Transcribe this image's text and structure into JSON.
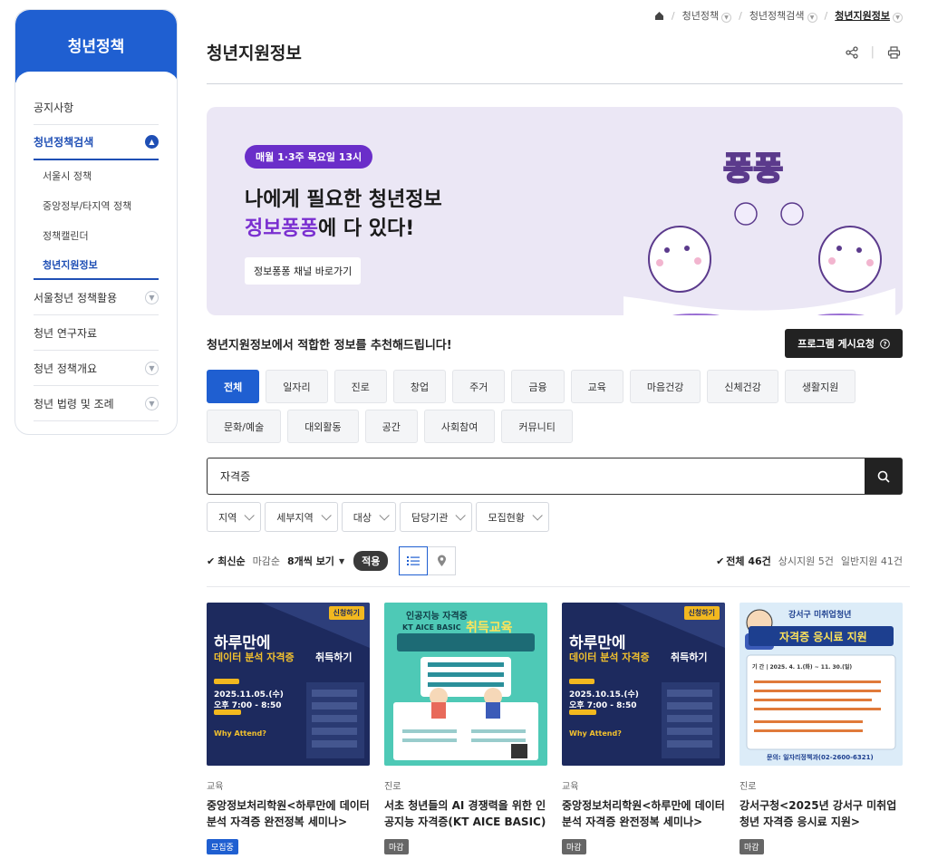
{
  "sidebar": {
    "title": "청년정책",
    "items": [
      {
        "label": "공지사항"
      },
      {
        "label": "청년정책검색"
      },
      {
        "label": "서울청년 정책활용"
      },
      {
        "label": "청년 연구자료"
      },
      {
        "label": "청년 정책개요"
      },
      {
        "label": "청년 법령 및 조례"
      }
    ],
    "subitems": [
      {
        "label": "서울시 정책"
      },
      {
        "label": "중앙정부/타지역 정책"
      },
      {
        "label": "정책캘린더"
      },
      {
        "label": "청년지원정보"
      }
    ]
  },
  "breadcrumb": {
    "items": [
      {
        "label": "청년정책"
      },
      {
        "label": "청년정책검색"
      },
      {
        "label": "청년지원정보"
      }
    ]
  },
  "page": {
    "title": "청년지원정보"
  },
  "banner": {
    "pill": "매월 1·3주 목요일 13시",
    "line1": "나에게 필요한 청년정보",
    "line2_accent": "정보퐁퐁",
    "line2_rest": "에 다 있다!",
    "button": "정보퐁퐁 채널 바로가기",
    "colors": {
      "bg": "#ebe7f5",
      "accent": "#7a2fd0"
    }
  },
  "recommend": {
    "text": "청년지원정보에서 적합한 정보를 추천해드립니다!",
    "program_button": "프로그램 게시요청"
  },
  "categories": [
    "전체",
    "일자리",
    "진로",
    "창업",
    "주거",
    "금융",
    "교육",
    "마음건강",
    "신체건강",
    "생활지원",
    "문화/예술",
    "대외활동",
    "공간",
    "사회참여",
    "커뮤니티"
  ],
  "search": {
    "value": "자격증"
  },
  "filters": [
    "지역",
    "세부지역",
    "대상",
    "담당기관",
    "모집현황"
  ],
  "sort": {
    "latest": "최신순",
    "deadline": "마감순",
    "per_page": "8개씩 보기",
    "apply": "적용",
    "total": "전체 46건",
    "always": "상시지원 5건",
    "general": "일반지원 41건"
  },
  "cards": [
    {
      "category": "교육",
      "title": "중앙정보처리학원<하루만에 데이터 분석 자격증 완전정복 세미나>",
      "status": "모집중",
      "thumb": {
        "tag": "신청하기",
        "headline": "하루만에",
        "sub": "데이터 분석 자격증",
        "sub2": "취득하기",
        "date": "2025.11.05.(수)",
        "time": "오후 7:00 - 8:50",
        "why": "Why Attend?"
      }
    },
    {
      "category": "진로",
      "title": "서초 청년들의 AI 경쟁력을 위한 인공지능 자격증(KT AICE BASIC) 취...",
      "status": "마감",
      "thumb": {
        "headline": "인공지능 자격증",
        "sub": "KT AICE BASIC",
        "sub2": "취득교육"
      }
    },
    {
      "category": "교육",
      "title": "중앙정보처리학원<하루만에 데이터 분석 자격증 완전정복 세미나>",
      "status": "마감",
      "thumb": {
        "tag": "신청하기",
        "headline": "하루만에",
        "sub": "데이터 분석 자격증",
        "sub2": "취득하기",
        "date": "2025.10.15.(수)",
        "time": "오후 7:00 - 8:50",
        "why": "Why Attend?"
      }
    },
    {
      "category": "진로",
      "title": "강서구청<2025년 강서구 미취업청년 자격증 응시료 지원>",
      "status": "마감",
      "thumb": {
        "headline": "강서구 미취업청년",
        "sub": "자격증 응시료 지원",
        "period": "기 간 | 2025. 4. 1.(화) ~ 11. 30.(일)",
        "contact": "문의: 일자리정책과(02-2600-6321)"
      }
    }
  ]
}
